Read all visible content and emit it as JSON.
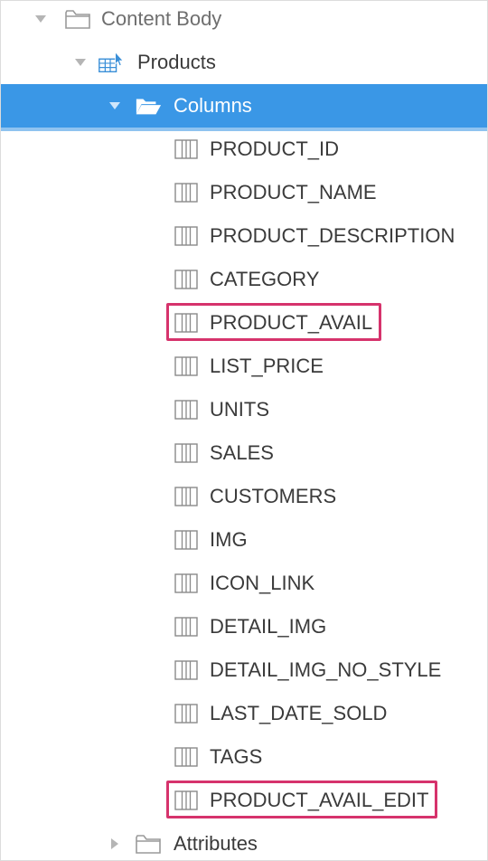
{
  "tree": {
    "content_body": {
      "label": "Content Body",
      "icon": "folder-icon",
      "expanded": true
    },
    "products": {
      "label": "Products",
      "icon": "table-region-icon",
      "expanded": true
    },
    "columns_folder": {
      "label": "Columns",
      "icon": "folder-open-icon",
      "expanded": true,
      "selected": true
    },
    "columns": [
      {
        "label": "PRODUCT_ID",
        "icon": "column-icon",
        "highlighted": false
      },
      {
        "label": "PRODUCT_NAME",
        "icon": "column-icon",
        "highlighted": false
      },
      {
        "label": "PRODUCT_DESCRIPTION",
        "icon": "column-icon",
        "highlighted": false
      },
      {
        "label": "CATEGORY",
        "icon": "column-icon",
        "highlighted": false
      },
      {
        "label": "PRODUCT_AVAIL",
        "icon": "column-icon",
        "highlighted": true
      },
      {
        "label": "LIST_PRICE",
        "icon": "column-icon",
        "highlighted": false
      },
      {
        "label": "UNITS",
        "icon": "column-icon",
        "highlighted": false
      },
      {
        "label": "SALES",
        "icon": "column-icon",
        "highlighted": false
      },
      {
        "label": "CUSTOMERS",
        "icon": "column-icon",
        "highlighted": false
      },
      {
        "label": "IMG",
        "icon": "column-icon",
        "highlighted": false
      },
      {
        "label": "ICON_LINK",
        "icon": "column-icon",
        "highlighted": false
      },
      {
        "label": "DETAIL_IMG",
        "icon": "column-icon",
        "highlighted": false
      },
      {
        "label": "DETAIL_IMG_NO_STYLE",
        "icon": "column-icon",
        "highlighted": false
      },
      {
        "label": "LAST_DATE_SOLD",
        "icon": "column-icon",
        "highlighted": false
      },
      {
        "label": "TAGS",
        "icon": "column-icon",
        "highlighted": false
      },
      {
        "label": "PRODUCT_AVAIL_EDIT",
        "icon": "column-icon",
        "highlighted": true
      }
    ],
    "attributes": {
      "label": "Attributes",
      "icon": "folder-icon",
      "expanded": false
    }
  },
  "colors": {
    "selected_bg": "#3a97e6",
    "highlight_border": "#d6336c",
    "text": "#3a3a3a"
  }
}
